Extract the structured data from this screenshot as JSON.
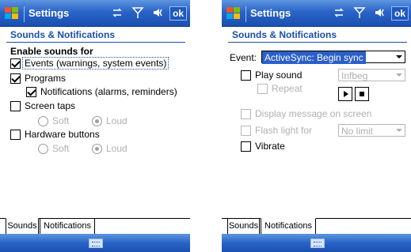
{
  "left": {
    "title": "Settings",
    "ok_label": "ok",
    "header": "Sounds & Notifications",
    "section_title": "Enable sounds for",
    "options": {
      "events": "Events (warnings, system events)",
      "programs": "Programs",
      "notifications": "Notifications (alarms, reminders)",
      "screen_taps": "Screen taps",
      "hardware_buttons": "Hardware buttons"
    },
    "radios": {
      "soft": "Soft",
      "loud": "Loud"
    },
    "tabs": {
      "sounds": "Sounds",
      "notifications": "Notifications"
    }
  },
  "right": {
    "title": "Settings",
    "ok_label": "ok",
    "header": "Sounds & Notifications",
    "event_label": "Event:",
    "event_value": "ActiveSync: Begin sync",
    "play_sound": "Play sound",
    "sound_value": "Infbeg",
    "repeat": "Repeat",
    "display_message": "Display message on screen",
    "flash_light": "Flash light for",
    "flash_value": "No limit",
    "vibrate": "Vibrate",
    "tabs": {
      "sounds": "Sounds",
      "notifications": "Notifications"
    }
  },
  "colors": {
    "titlebar": "#2a64c8",
    "header_text": "#1b4fa8",
    "selection": "#2a5fc8"
  }
}
